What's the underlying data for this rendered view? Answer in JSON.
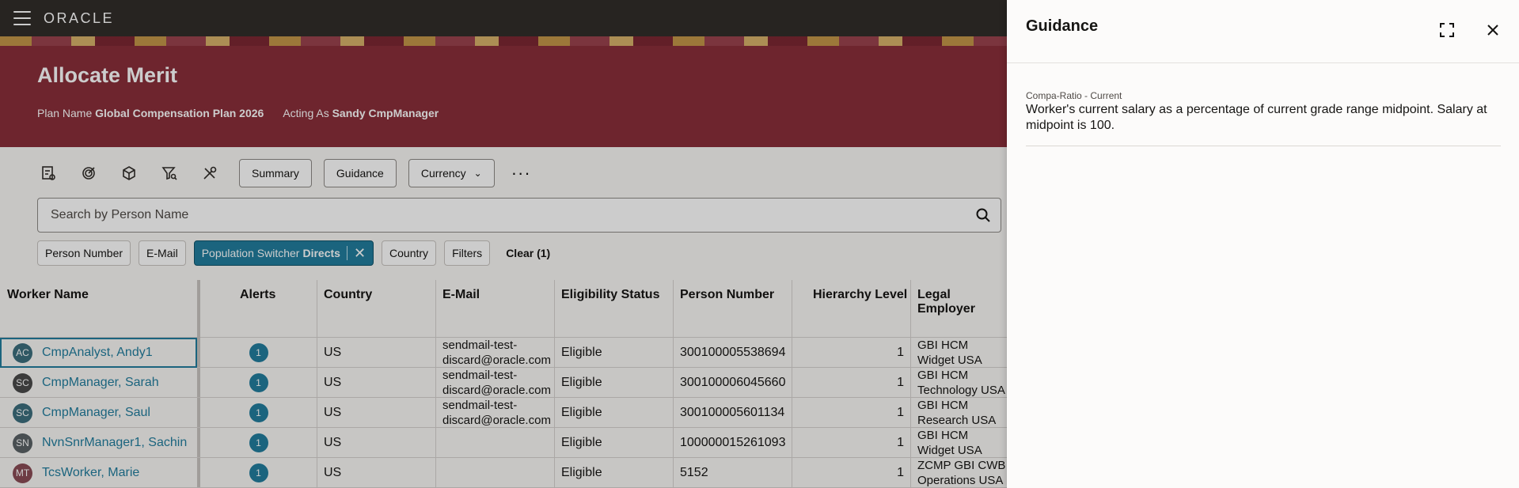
{
  "app": {
    "logo": "ORACLE"
  },
  "page": {
    "title": "Allocate Merit",
    "plan_name_label": "Plan Name",
    "plan_name_value": "Global Compensation Plan 2026",
    "acting_as_label": "Acting As",
    "acting_as_value": "Sandy CmpManager"
  },
  "toolbar": {
    "icons": [
      "report-icon",
      "target-icon",
      "cube-icon",
      "filter-search-icon",
      "tools-icon"
    ],
    "summary_label": "Summary",
    "guidance_label": "Guidance",
    "currency_label": "Currency",
    "more_label": "···"
  },
  "search": {
    "placeholder": "Search by Person Name"
  },
  "filters": {
    "person_number": "Person Number",
    "email": "E-Mail",
    "population_prefix": "Population Switcher",
    "population_value": "Directs",
    "country": "Country",
    "filters": "Filters",
    "clear": "Clear (1)"
  },
  "table": {
    "headers": {
      "worker_name": "Worker Name",
      "alerts": "Alerts",
      "country": "Country",
      "email": "E-Mail",
      "eligibility": "Eligibility Status",
      "person_number": "Person Number",
      "hierarchy": "Hierarchy Level",
      "legal_employer": "Legal Employer"
    },
    "rows": [
      {
        "initials": "AC",
        "avatar_color": "#3c6e7d",
        "name": "CmpAnalyst, Andy1",
        "alerts": "1",
        "country": "US",
        "email": "sendmail-test-discard@oracle.com",
        "eligibility": "Eligible",
        "person_number": "300100005538694",
        "hierarchy": "1",
        "legal_employer": "GBI HCM Widget USA"
      },
      {
        "initials": "SC",
        "avatar_color": "#4a4a4a",
        "name": "CmpManager, Sarah",
        "alerts": "1",
        "country": "US",
        "email": "sendmail-test-discard@oracle.com",
        "eligibility": "Eligible",
        "person_number": "300100006045660",
        "hierarchy": "1",
        "legal_employer": "GBI HCM Technology USA"
      },
      {
        "initials": "SC",
        "avatar_color": "#3c6e7d",
        "name": "CmpManager, Saul",
        "alerts": "1",
        "country": "US",
        "email": "sendmail-test-discard@oracle.com",
        "eligibility": "Eligible",
        "person_number": "300100005601134",
        "hierarchy": "1",
        "legal_employer": "GBI HCM Research USA"
      },
      {
        "initials": "SN",
        "avatar_color": "#5a6266",
        "name": "NvnSnrManager1, Sachin",
        "alerts": "1",
        "country": "US",
        "email": "",
        "eligibility": "Eligible",
        "person_number": "100000015261093",
        "hierarchy": "1",
        "legal_employer": "GBI HCM Widget USA"
      },
      {
        "initials": "MT",
        "avatar_color": "#8a4c55",
        "name": "TcsWorker, Marie",
        "alerts": "1",
        "country": "US",
        "email": "",
        "eligibility": "Eligible",
        "person_number": "5152",
        "hierarchy": "1",
        "legal_employer": "ZCMP GBI CWB Operations USA"
      }
    ]
  },
  "drawer": {
    "title": "Guidance",
    "item_label": "Compa-Ratio - Current",
    "item_text": "Worker's current salary as a percentage of current grade range midpoint. Salary at midpoint is 100."
  }
}
